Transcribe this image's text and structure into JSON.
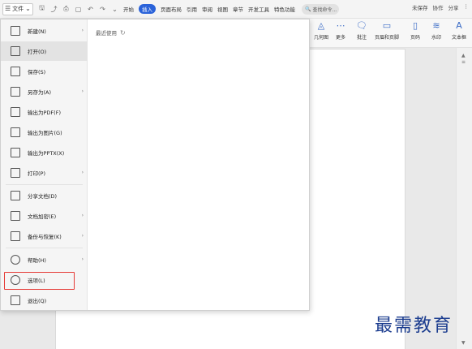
{
  "menubar": {
    "file_label": "文件",
    "tabs": [
      "开始",
      "插入",
      "页面布局",
      "引用",
      "审阅",
      "视图",
      "章节",
      "开发工具",
      "特色功能"
    ],
    "search_placeholder": "查找命令...",
    "right": [
      "未保存",
      "协作",
      "分享"
    ]
  },
  "ribbon": {
    "buttons": [
      "几何图",
      "更多",
      "批注",
      "页眉和页脚",
      "页码",
      "水印",
      "文本框"
    ]
  },
  "file_menu": {
    "items": [
      {
        "label": "新建(N)",
        "arrow": true
      },
      {
        "label": "打开(O)",
        "arrow": false
      },
      {
        "label": "保存(S)",
        "arrow": false
      },
      {
        "label": "另存为(A)",
        "arrow": true
      },
      {
        "label": "输出为PDF(F)",
        "arrow": false
      },
      {
        "label": "输出为图片(G)",
        "arrow": false
      },
      {
        "label": "输出为PPTX(X)",
        "arrow": false
      },
      {
        "label": "打印(P)",
        "arrow": true
      },
      {
        "label": "分享文档(D)",
        "arrow": false
      },
      {
        "label": "文档加密(E)",
        "arrow": true
      },
      {
        "label": "备份与恢复(K)",
        "arrow": true
      },
      {
        "label": "帮助(H)",
        "arrow": true
      },
      {
        "label": "选项(L)",
        "arrow": false
      },
      {
        "label": "退出(Q)",
        "arrow": false
      }
    ],
    "recent_label": "最近使用"
  },
  "watermark": "最需教育",
  "colors": {
    "accent": "#2a62d9",
    "highlight": "#e53935"
  }
}
